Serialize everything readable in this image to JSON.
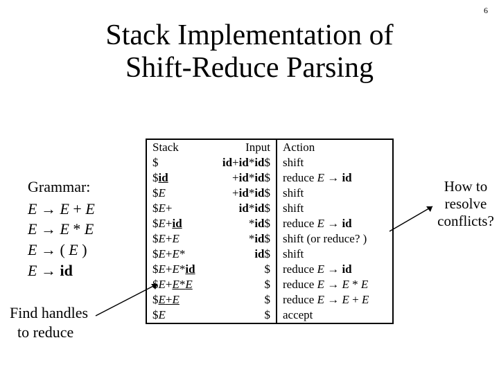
{
  "page_number": "6",
  "title_line1": "Stack Implementation of",
  "title_line2": "Shift-Reduce Parsing",
  "grammar": {
    "label": "Grammar:",
    "rules": [
      {
        "lhs": "E",
        "rhs": "E + E"
      },
      {
        "lhs": "E",
        "rhs": "E * E"
      },
      {
        "lhs": "E",
        "rhs": "( E )"
      },
      {
        "lhs": "E",
        "rhs": "id"
      }
    ]
  },
  "find_line1": "Find handles",
  "find_line2": "to reduce",
  "howto_line1": "How to",
  "howto_line2": "resolve",
  "howto_line3": "conflicts?",
  "table": {
    "head": {
      "stack": "Stack",
      "input": "Input",
      "action": "Action"
    },
    "rows": [
      {
        "stack": "$",
        "input": "id+id*id$",
        "action": "shift"
      },
      {
        "stack": "$id",
        "input": "+id*id$",
        "action": "reduce E → id",
        "u": "id"
      },
      {
        "stack": "$E",
        "input": "+id*id$",
        "action": "shift"
      },
      {
        "stack": "$E+",
        "input": "id*id$",
        "action": "shift"
      },
      {
        "stack": "$E+id",
        "input": "*id$",
        "action": "reduce E → id",
        "u": "id"
      },
      {
        "stack": "$E+E",
        "input": "*id$",
        "action": "shift (or reduce? )"
      },
      {
        "stack": "$E+E*",
        "input": "id$",
        "action": "shift"
      },
      {
        "stack": "$E+E*id",
        "input": "$",
        "action": "reduce E → id",
        "u": "id"
      },
      {
        "stack": "$E+E*E",
        "input": "$",
        "action": "reduce E → E * E",
        "u": "E*E"
      },
      {
        "stack": "$E+E",
        "input": "$",
        "action": "reduce E → E + E",
        "u": "E+E"
      },
      {
        "stack": "$E",
        "input": "$",
        "action": "accept"
      }
    ]
  }
}
